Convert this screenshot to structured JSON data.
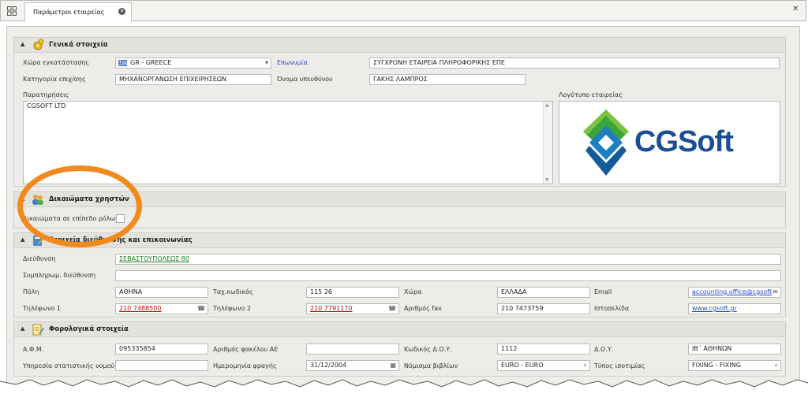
{
  "tab": {
    "title": "Παράμετροι εταιρείας"
  },
  "colors": {
    "accent": "#f08a1c",
    "label_blue": "#2a46c8",
    "link_green": "#1c7a1c",
    "link_red": "#b01010"
  },
  "general": {
    "title": "Γενικά στοιχεία",
    "country_label": "Χώρα εγκατάστασης",
    "country_value": "GR - GREECE",
    "company_name_label": "Επωνυμία",
    "company_name_value": "ΣΥΓΧΡΟΝΗ ΕΤΑΙΡΕΙΑ ΠΛΗΡΟΦΟΡΙΚΗΣ ΕΠΕ",
    "category_label": "Κατηγορία επιχ/σης",
    "category_value": "ΜΗΧΑΝΟΡΓΑΝΩΣΗ ΕΠΙΧΕΙΡΗΣΕΩΝ",
    "manager_label": "Όνομα υπευθύνου",
    "manager_value": "ΓΑΚΗΣ ΛΑΜΠΡΟΣ",
    "notes_label": "Παρατηρήσεις",
    "notes_value": "CGSOFT LTD",
    "logo_label": "Λογότυπο εταιρείας",
    "logo_text": "CGSoft"
  },
  "rights": {
    "title": "Δικαιώματα χρηστών",
    "role_rights_label": "Δικαιώματα σε επίπεδο ρόλων"
  },
  "address": {
    "title": "Στοιχεία διεύθυνσης και επικοινωνίας",
    "address_label": "Διεύθυνση",
    "address_value": "ΣΕΒΑΣΤΟΥΠΟΛΕΩΣ 80",
    "address2_label": "Συμπληρωμ. διεύθυνση",
    "address2_value": "",
    "city_label": "Πόλη",
    "city_value": "ΑΘΗΝΑ",
    "postal_label": "Ταχ.κωδικός",
    "postal_value": "115 26",
    "country_label": "Χώρα",
    "country_value": "ΕΛΛΑΔΑ",
    "email_label": "Email",
    "email_value": "accounting.office@cgsoft",
    "phone1_label": "Τηλέφωνο 1",
    "phone1_value": "210 7488500",
    "phone2_label": "Τηλέφωνο 2",
    "phone2_value": "210 7791170",
    "fax_label": "Αριθμός fax",
    "fax_value": "210 7473759",
    "website_label": "Ιστοσελίδα",
    "website_value": "www.cgsoft.gr"
  },
  "tax": {
    "title": "Φορολογικά στοιχεία",
    "afm_label": "Α.Φ.Μ.",
    "afm_value": "095335854",
    "ae_file_label": "Αριθμός φακέλου ΑΕ",
    "ae_file_value": "",
    "doy_code_label": "Κωδικός Δ.Ο.Υ.",
    "doy_code_value": "1112",
    "doy_label": "Δ.Ο.Υ.",
    "doy_value": "ΙΒ΄ ΑΘΗΝΩΝ",
    "stats_label": "Υπηρεσία στατιστικής νομού",
    "stats_value": "",
    "closing_date_label": "Ημερομηνία φραγής",
    "closing_date_value": "31/12/2004",
    "currency_label": "Νόμισμα βιβλίων",
    "currency_value": "EURO - EURO",
    "parity_label": "Τύπος ισοτιμίας",
    "parity_value": "FIXING - FIXING"
  }
}
